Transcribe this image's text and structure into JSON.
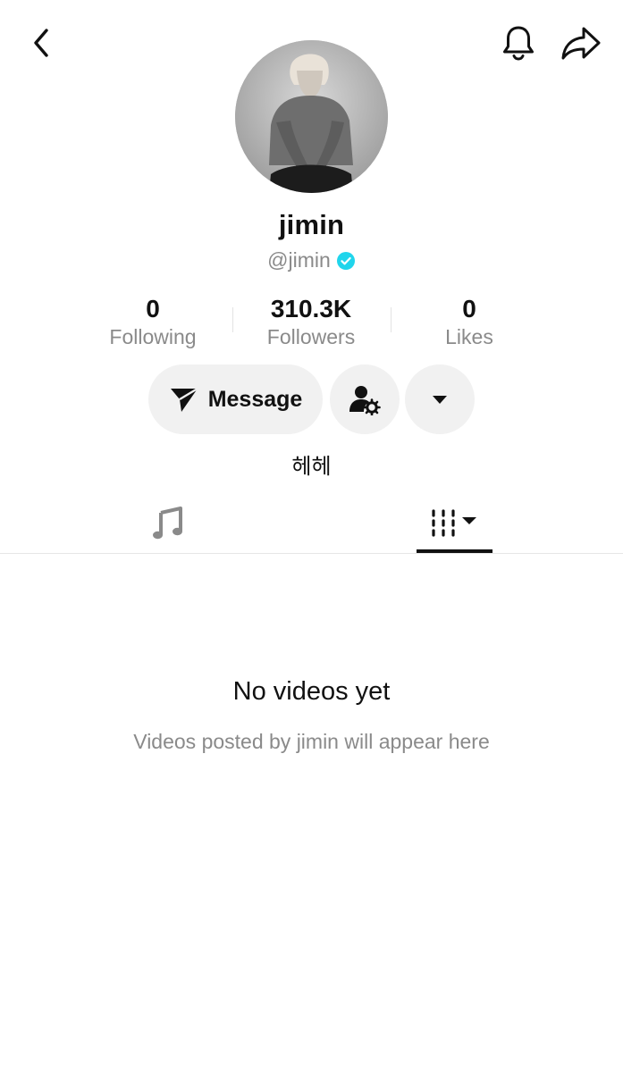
{
  "profile": {
    "display_name": "jimin",
    "handle": "@jimin",
    "verified": true,
    "bio": "헤헤"
  },
  "stats": [
    {
      "value": "0",
      "label": "Following"
    },
    {
      "value": "310.3K",
      "label": "Followers"
    },
    {
      "value": "0",
      "label": "Likes"
    }
  ],
  "actions": {
    "message_label": "Message"
  },
  "tabs": [
    {
      "icon": "music-note-icon",
      "active": false
    },
    {
      "icon": "videos-grid-icon",
      "active": true
    }
  ],
  "empty_state": {
    "title": "No videos yet",
    "subtitle": "Videos posted by jimin will appear here"
  },
  "colors": {
    "text": "#111111",
    "muted": "#8a8a8a",
    "button_bg": "#f1f1f1",
    "verified": "#20d5ec"
  }
}
